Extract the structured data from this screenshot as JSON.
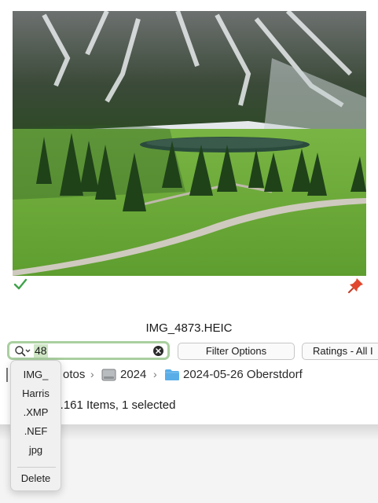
{
  "preview": {
    "filename": "IMG_4873.HEIC",
    "image_icon": "alpine-lake-photo",
    "accept_icon": "check-icon",
    "pin_icon": "pin-icon"
  },
  "toolbar": {
    "search_value": "48",
    "search_icon": "search-icon",
    "clear_icon": "clear-icon",
    "filter_label": "Filter Options",
    "ratings_label": "Ratings - All I"
  },
  "path": {
    "photos": "otos",
    "year": "2024",
    "folder": "2024-05-26 Oberstdorf",
    "separator": "›"
  },
  "status": {
    "text": "f 1.161  Items, 1 selected"
  },
  "recent_searches": {
    "items": [
      "IMG_",
      "Harris",
      ".XMP",
      ".NEF",
      "jpg"
    ],
    "delete_label": "Delete"
  },
  "colors": {
    "accent_green": "#a9cfa0",
    "check_green": "#3fa24a",
    "pin_red": "#e0472e",
    "folder_blue": "#5aaee8"
  }
}
